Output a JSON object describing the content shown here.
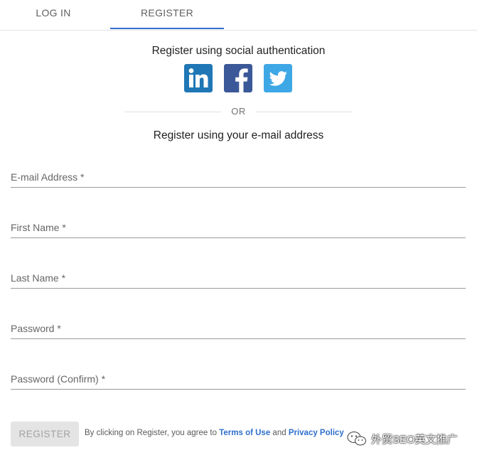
{
  "tabs": {
    "login": "LOG IN",
    "register": "REGISTER",
    "active": "register",
    "accent_color": "#2f6fcd"
  },
  "social": {
    "heading": "Register using social authentication",
    "providers": [
      {
        "name": "linkedin",
        "icon": "linkedin-icon",
        "color": "#1f77b5"
      },
      {
        "name": "facebook",
        "icon": "facebook-icon",
        "color": "#3b5998"
      },
      {
        "name": "twitter",
        "icon": "twitter-icon",
        "color": "#3ea7e6"
      }
    ]
  },
  "divider": {
    "text": "OR"
  },
  "email": {
    "heading": "Register using your e-mail address"
  },
  "form": {
    "fields": [
      {
        "label": "E-mail Address *",
        "value": ""
      },
      {
        "label": "First Name *",
        "value": ""
      },
      {
        "label": "Last Name *",
        "value": ""
      },
      {
        "label": "Password *",
        "value": ""
      },
      {
        "label": "Password (Confirm) *",
        "value": ""
      }
    ],
    "submit_label": "REGISTER"
  },
  "terms": {
    "prefix": "By clicking on Register, you agree to ",
    "terms_link": "Terms of Use",
    "middle": " and ",
    "privacy_link": "Privacy Policy"
  },
  "watermark": {
    "text": "外贸SEO英文推广",
    "icon": "wechat-icon"
  }
}
